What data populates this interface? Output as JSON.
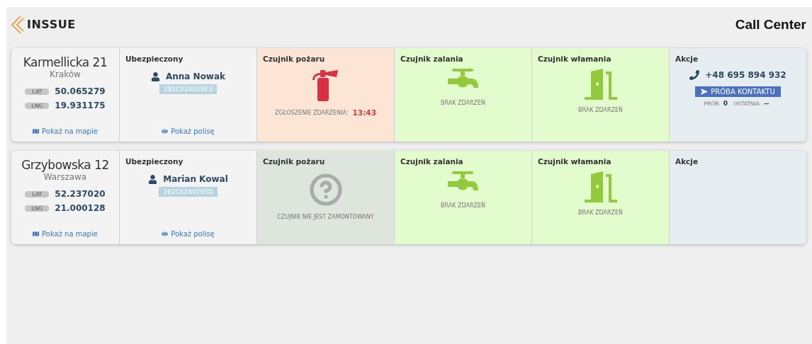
{
  "header": {
    "logo": "INSSUE",
    "title": "Call Center"
  },
  "locations": [
    {
      "street": "Karmellicka 21",
      "city": "Kraków",
      "coords": [
        {
          "label": "LAT",
          "value": "50.065279"
        },
        {
          "label": "LNG",
          "value": "19.931175"
        }
      ],
      "map_link": "Pokaż na mapie",
      "insured": {
        "heading": "Ubezpieczony",
        "name": "Anna Nowak",
        "policy_id": "282C024029E3",
        "policy_link": "Pokaż polisę"
      },
      "sensors": [
        {
          "heading": "Czujnik pożaru",
          "kind": "fire",
          "installed": true,
          "alarm": true,
          "status": "ZGŁOSZENIE ZDARZENIA:",
          "time": "13:43"
        },
        {
          "heading": "Czujnik zalania",
          "kind": "flood",
          "installed": true,
          "alarm": false,
          "status": "BRAK ZDARZEŃ"
        },
        {
          "heading": "Czujnik włamania",
          "kind": "burglary",
          "installed": true,
          "alarm": false,
          "status": "BRAK ZDARZEŃ"
        }
      ],
      "actions": {
        "heading": "Akcje",
        "phone": "+48 695 894 932",
        "contact_button": "PRÓBA KONTAKTU",
        "attempts_label": "PRÓB:",
        "attempts": "0",
        "last_label": "OSTATNIA:",
        "last": "--"
      }
    },
    {
      "street": "Grzybowska 12",
      "city": "Warszawa",
      "coords": [
        {
          "label": "LAT",
          "value": "52.237020"
        },
        {
          "label": "LNG",
          "value": "21.000128"
        }
      ],
      "map_link": "Pokaż na mapie",
      "insured": {
        "heading": "Ubezpieczony",
        "name": "Marian Kowal",
        "policy_id": "282C0240295D",
        "policy_link": "Pokaż polisę"
      },
      "sensors": [
        {
          "heading": "Czujnik pożaru",
          "kind": "fire",
          "installed": false,
          "status": "CZUJNIK NIE JEST ZAMONTOWANY"
        },
        {
          "heading": "Czujnik zalania",
          "kind": "flood",
          "installed": true,
          "alarm": false,
          "status": "BRAK ZDARZEŃ"
        },
        {
          "heading": "Czujnik włamania",
          "kind": "burglary",
          "installed": true,
          "alarm": false,
          "status": "BRAK ZDARZEŃ"
        }
      ],
      "actions": {
        "heading": "Akcje"
      }
    }
  ]
}
